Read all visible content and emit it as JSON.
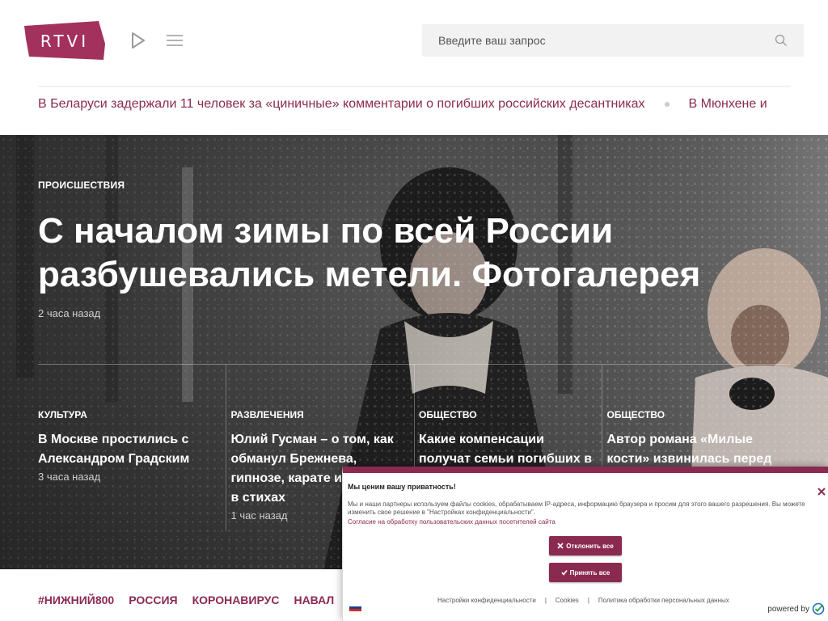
{
  "header": {
    "logo_text": "RTVI",
    "brand_color": "#a3315e",
    "search": {
      "placeholder": "Введите ваш запрос",
      "value": ""
    }
  },
  "ticker": {
    "items": [
      "В Беларуси задержали 11 человек за «циничные» комментарии о погибших российских десантниках",
      "В Мюнхене и"
    ]
  },
  "hero": {
    "category": "ПРОИСШЕСТВИЯ",
    "title": "С началом зимы по всей России разбушевались метели. Фотогалерея",
    "time": "2 часа назад"
  },
  "cards": [
    {
      "category": "КУЛЬТУРА",
      "title": "В Москве простились с Александром Градским",
      "time": "3 часа назад"
    },
    {
      "category": "РАЗВЛЕЧЕНИЯ",
      "title": "Юлий Гусман – о том, как обманул Брежнева, гипнозе, карате и рекламе в стихах",
      "time": "1 час назад"
    },
    {
      "category": "ОБЩЕСТВО",
      "title": "Какие компенсации получат семьи погибших в шахте",
      "time": ""
    },
    {
      "category": "ОБЩЕСТВО",
      "title": "Автор романа «Милые кости» извинилась перед",
      "time": ""
    }
  ],
  "tags": [
    "#НИЖНИЙ800",
    "РОССИЯ",
    "КОРОНАВИРУС",
    "НАВАЛ"
  ],
  "cookie": {
    "title": "Мы ценим вашу приватность!",
    "text": "Мы и наши партнеры используем файлы cookies, обрабатываем IP-адреса, информацию браузера и просим для этого вашего разрешения. Вы можете изменить свое решение в \"Настройках конфиденциальности\".",
    "consent_link": "Согласие на обработку пользовательских данных посетителей сайта",
    "reject_label": "Отклонить все",
    "accept_label": "Принять все",
    "footer_links": [
      "Настройки конфиденциальности",
      "Cookies",
      "Политика обработки персональных данных"
    ],
    "separator": "|",
    "powered_by": "powered by"
  }
}
